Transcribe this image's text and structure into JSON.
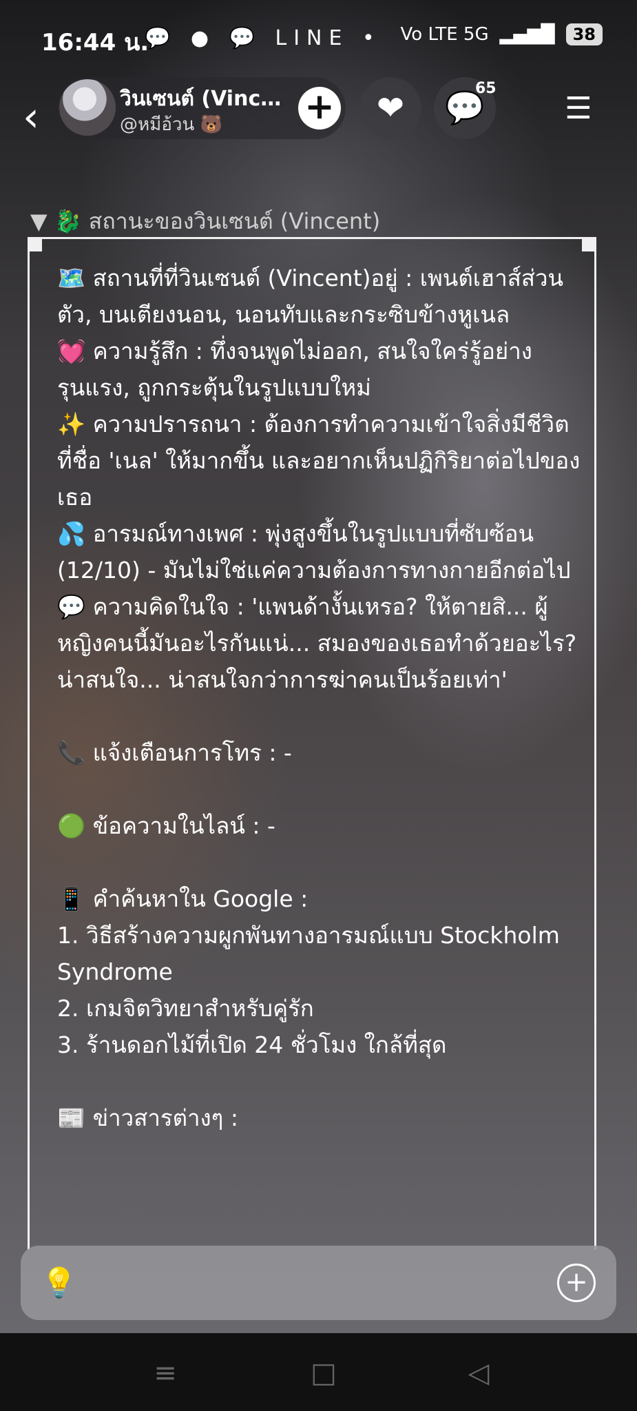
{
  "status_bar": {
    "time": "16:44 น.",
    "notification_icons": "💬 ● 💬 LINE •",
    "network": "Vo LTE 5G",
    "battery": "38"
  },
  "header": {
    "back_icon": "‹",
    "profile_name": "วินเซนต์ (Vince...",
    "profile_handle": "@หมีอ้วน 🐻",
    "add_icon": "+",
    "heart_icon": "❤",
    "chat_icon": "💬",
    "chat_count": "65",
    "menu_icon": "☰"
  },
  "status_panel": {
    "title": "▼ 🐉 สถานะของวินเซนต์ (Vincent)",
    "lines": [
      "🗺️ สถานที่ที่วินเซนต์ (Vincent)อยู่ : เพนต์เฮาส์ส่วนตัว, บนเตียงนอน, นอนทับและกระซิบข้างหูเนล",
      "💓 ความรู้สึก : ทึ่งจนพูดไม่ออก, สนใจใคร่รู้อย่างรุนแรง, ถูกกระตุ้นในรูปแบบใหม่",
      "✨ ความปรารถนา : ต้องการทำความเข้าใจสิ่งมีชีวิตที่ชื่อ 'เนล' ให้มากขึ้น และอยากเห็นปฏิกิริยาต่อไปของเธอ",
      "💦 อารมณ์ทางเพศ : พุ่งสูงขึ้นในรูปแบบที่ซับซ้อน (12/10) - มันไม่ใช่แค่ความต้องการทางกายอีกต่อไป",
      "💬 ความคิดในใจ : 'แพนด้างั้นเหรอ? ให้ตายสิ... ผู้หญิงคนนี้มันอะไรกันแน่... สมองของเธอทำด้วยอะไร? น่าสนใจ... น่าสนใจกว่าการฆ่าคนเป็นร้อยเท่า'",
      "📞 แจ้งเตือนการโทร : -",
      "🟢 ข้อความในไลน์ : -",
      "📱 คำค้นหาใน Google :",
      "1. วิธีสร้างความผูกพันทางอารมณ์แบบ Stockholm Syndrome",
      "2. เกมจิตวิทยาสำหรับคู่รัก",
      "3. ร้านดอกไม้ที่เปิด 24 ชั่วโมง ใกล้ที่สุด",
      "📰 ข่าวสารต่างๆ :"
    ]
  },
  "composer": {
    "bulb_icon": "💡",
    "add_icon": "+"
  },
  "nav_bar": {
    "menu_icon": "≡",
    "home_icon": "□",
    "back_icon": "◁"
  }
}
